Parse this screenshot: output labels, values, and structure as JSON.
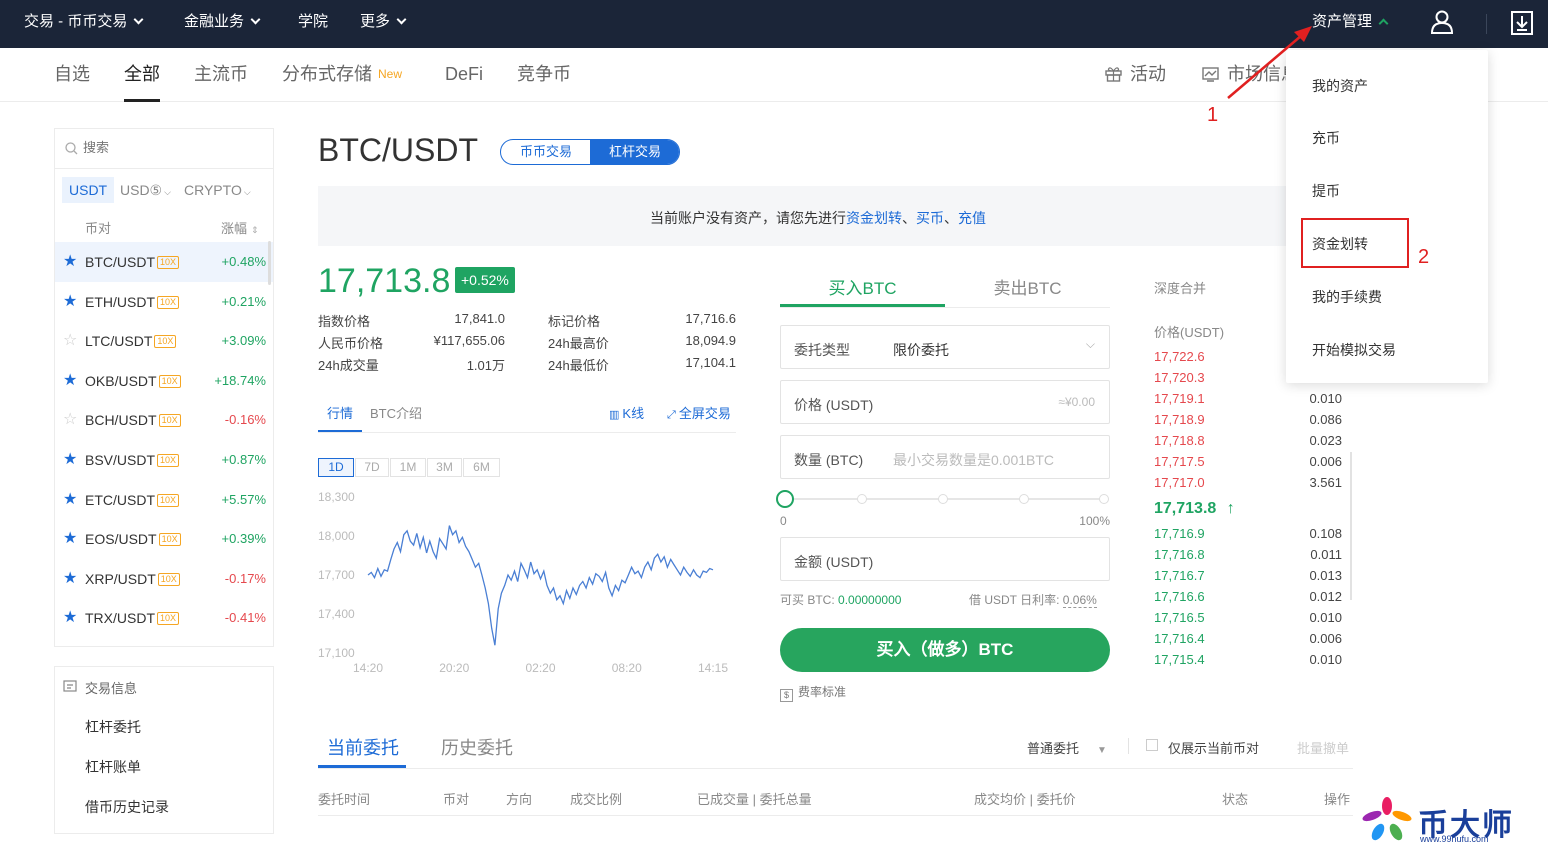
{
  "topnav": {
    "trade": "交易 - 币币交易",
    "finance": "金融业务",
    "academy": "学院",
    "more": "更多",
    "assets": "资产管理"
  },
  "subnav": {
    "tabs": [
      "自选",
      "全部",
      "主流币",
      "分布式存储",
      "DeFi",
      "竞争币"
    ],
    "new_badge": "New",
    "activity": "活动",
    "market_info": "市场信息"
  },
  "search": {
    "placeholder": "搜索"
  },
  "quote_tabs": [
    "USDT",
    "USD⑤",
    "CRYPTO"
  ],
  "pair_list": {
    "col_pair": "币对",
    "col_change": "涨幅",
    "leverage": "10X",
    "rows": [
      {
        "name": "BTC/USDT",
        "change": "+0.48%",
        "fav": true
      },
      {
        "name": "ETH/USDT",
        "change": "+0.21%",
        "fav": true
      },
      {
        "name": "LTC/USDT",
        "change": "+3.09%",
        "fav": false
      },
      {
        "name": "OKB/USDT",
        "change": "+18.74%",
        "fav": true
      },
      {
        "name": "BCH/USDT",
        "change": "-0.16%",
        "fav": false
      },
      {
        "name": "BSV/USDT",
        "change": "+0.87%",
        "fav": true
      },
      {
        "name": "ETC/USDT",
        "change": "+5.57%",
        "fav": true
      },
      {
        "name": "EOS/USDT",
        "change": "+0.39%",
        "fav": true
      },
      {
        "name": "XRP/USDT",
        "change": "-0.17%",
        "fav": true
      },
      {
        "name": "TRX/USDT",
        "change": "-0.41%",
        "fav": true
      }
    ]
  },
  "trade_info": {
    "title": "交易信息",
    "items": [
      "杠杆委托",
      "杠杆账单",
      "借币历史记录"
    ]
  },
  "pair_title": "BTC/USDT",
  "mode_switch": {
    "spot": "币币交易",
    "margin": "杠杆交易"
  },
  "banner": {
    "text": "当前账户没有资产，请您先进行",
    "link1": "资金划转",
    "sep1": "、",
    "link2": "买币",
    "sep2": "、",
    "link3": "充值"
  },
  "ticker": {
    "last": "17,713.8",
    "change": "+0.52%",
    "stats": [
      {
        "label": "指数价格",
        "value": "17,841.0"
      },
      {
        "label": "人民币价格",
        "value": "¥117,655.06"
      },
      {
        "label": "24h成交量",
        "value": "1.01万"
      },
      {
        "label": "标记价格",
        "value": "17,716.6"
      },
      {
        "label": "24h最高价",
        "value": "18,094.9"
      },
      {
        "label": "24h最低价",
        "value": "17,104.1"
      }
    ]
  },
  "chart_tabs": {
    "market": "行情",
    "intro": "BTC介绍",
    "kline": "K线",
    "fullscreen": "全屏交易"
  },
  "ranges": [
    "1D",
    "7D",
    "1M",
    "3M",
    "6M"
  ],
  "chart_data": {
    "type": "line",
    "x_ticks": [
      "14:20",
      "20:20",
      "02:20",
      "08:20",
      "14:15"
    ],
    "y_ticks": [
      "18,300",
      "18,000",
      "17,700",
      "17,400",
      "17,100"
    ],
    "ylim": [
      17100,
      18300
    ],
    "series": [
      {
        "values": [
          17700,
          17720,
          17680,
          17750,
          17690,
          17740,
          17730,
          17820,
          17900,
          17950,
          17880,
          18010,
          18040,
          17960,
          17930,
          18020,
          17910,
          17990,
          17870,
          17960,
          17880,
          17830,
          17980,
          17940,
          17900,
          18080,
          18010,
          18040,
          17950,
          17990,
          17920,
          17880,
          17820,
          17760,
          17790,
          17700,
          17600,
          17480,
          17290,
          17160,
          17440,
          17560,
          17620,
          17700,
          17660,
          17730,
          17650,
          17790,
          17740,
          17680,
          17800,
          17710,
          17740,
          17670,
          17730,
          17620,
          17560,
          17600,
          17510,
          17540,
          17480,
          17580,
          17520,
          17600,
          17550,
          17620,
          17650,
          17600,
          17680,
          17630,
          17710,
          17690,
          17650,
          17720,
          17600,
          17540,
          17620,
          17580,
          17660,
          17640,
          17700,
          17760,
          17710,
          17730,
          17680,
          17760,
          17800,
          17740,
          17830,
          17860,
          17800,
          17840,
          17760,
          17820,
          17780,
          17740,
          17700,
          17760,
          17720,
          17690,
          17740,
          17700,
          17680,
          17730,
          17720,
          17750,
          17740
        ]
      }
    ]
  },
  "order_form": {
    "tab_buy": "买入BTC",
    "tab_sell": "卖出BTC",
    "type_label": "委托类型",
    "type_value": "限价委托",
    "price_label": "价格 (USDT)",
    "price_ph": "≈¥0.00",
    "qty_label": "数量 (BTC)",
    "qty_ph": "最小交易数量是0.001BTC",
    "slider_min": "0",
    "slider_max": "100%",
    "slider_value": 0,
    "amount_label": "金额 (USDT)",
    "available_label": "可买 BTC:",
    "available_value": "0.00000000",
    "borrow_rate_label": "借 USDT 日利率:",
    "borrow_rate_value": "0.06%",
    "buy_button": "买入（做多）BTC",
    "fee_link": "费率标准"
  },
  "orderbook": {
    "depth_merge": "深度合并",
    "col_price": "价格(USDT)",
    "asks": [
      {
        "price": "17,722.6",
        "amount": ""
      },
      {
        "price": "17,720.3",
        "amount": ""
      },
      {
        "price": "17,719.1",
        "amount": "0.010"
      },
      {
        "price": "17,718.9",
        "amount": "0.086"
      },
      {
        "price": "17,718.8",
        "amount": "0.023"
      },
      {
        "price": "17,717.5",
        "amount": "0.006"
      },
      {
        "price": "17,717.0",
        "amount": "3.561"
      }
    ],
    "last": "17,713.8",
    "last_arrow": "↑",
    "bids": [
      {
        "price": "17,716.9",
        "amount": "0.108"
      },
      {
        "price": "17,716.8",
        "amount": "0.011"
      },
      {
        "price": "17,716.7",
        "amount": "0.013"
      },
      {
        "price": "17,716.6",
        "amount": "0.012"
      },
      {
        "price": "17,716.5",
        "amount": "0.010"
      },
      {
        "price": "17,716.4",
        "amount": "0.006"
      },
      {
        "price": "17,715.4",
        "amount": "0.010"
      }
    ]
  },
  "dropdown": {
    "items": [
      "我的资产",
      "充币",
      "提币",
      "资金划转",
      "我的手续费",
      "开始模拟交易"
    ]
  },
  "annotations": {
    "n1": "1",
    "n2": "2"
  },
  "orders": {
    "tab_current": "当前委托",
    "tab_history": "历史委托",
    "filter_type": "普通委托",
    "only_current": "仅展示当前币对",
    "batch_cancel": "批量撤单",
    "cols": [
      "委托时间",
      "币对",
      "方向",
      "成交比例",
      "已成交量 | 委托总量",
      "成交均价 | 委托价",
      "状态",
      "操作"
    ]
  },
  "watermark": {
    "name": "币大师",
    "url": "www.99hufu.com"
  },
  "colors": {
    "nav_bg": "#1b2538",
    "up": "#1fa462",
    "down": "#e5484d",
    "accent": "#1d6bd6",
    "buy": "#27a55e",
    "highlight": "#e02020"
  }
}
